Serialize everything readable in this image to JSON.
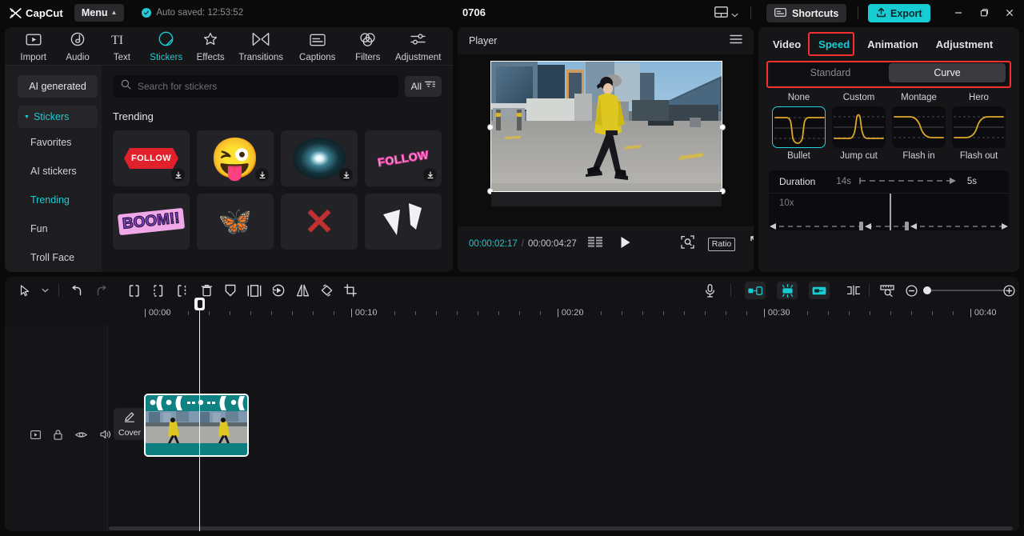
{
  "titlebar": {
    "brand": "CapCut",
    "menu_label": "Menu",
    "autosave": "Auto saved: 12:53:52",
    "project_title": "0706",
    "shortcuts_label": "Shortcuts",
    "export_label": "Export",
    "layout_icon": "layout-icon",
    "minimize_icon": "minimize-icon",
    "maximize_icon": "maximize-icon",
    "close_icon": "close-icon"
  },
  "left_panel": {
    "tabs": [
      {
        "label": "Import",
        "icon": "import-icon",
        "active": false
      },
      {
        "label": "Audio",
        "icon": "audio-icon",
        "active": false
      },
      {
        "label": "Text",
        "icon": "text-icon",
        "active": false
      },
      {
        "label": "Stickers",
        "icon": "stickers-icon",
        "active": true
      },
      {
        "label": "Effects",
        "icon": "effects-icon",
        "active": false
      },
      {
        "label": "Transitions",
        "icon": "transitions-icon",
        "active": false
      },
      {
        "label": "Captions",
        "icon": "captions-icon",
        "active": false
      },
      {
        "label": "Filters",
        "icon": "filters-icon",
        "active": false
      },
      {
        "label": "Adjustment",
        "icon": "adjustment-icon",
        "active": false
      }
    ],
    "sidebar": {
      "ai_generated": "AI generated",
      "group_label": "Stickers",
      "items": [
        {
          "label": "Favorites",
          "selected": false
        },
        {
          "label": "AI stickers",
          "selected": false
        },
        {
          "label": "Trending",
          "selected": true
        },
        {
          "label": "Fun",
          "selected": false
        },
        {
          "label": "Troll Face",
          "selected": false
        }
      ]
    },
    "search": {
      "placeholder": "Search for stickers",
      "value": "",
      "icon": "search-icon"
    },
    "filter_button": {
      "label": "All",
      "icon": "filter-icon"
    },
    "section_title": "Trending",
    "stickers": [
      {
        "name": "follow-red-banner-sticker",
        "art": "follow-red",
        "text": "FOLLOW"
      },
      {
        "name": "winking-tongue-emoji-sticker",
        "art": "emoji",
        "text": "😜"
      },
      {
        "name": "sparkle-burst-sticker",
        "art": "spark",
        "text": ""
      },
      {
        "name": "follow-pink-outline-sticker",
        "art": "follow-pink",
        "text": "FOLLOW"
      },
      {
        "name": "boom-comic-sticker",
        "art": "boom",
        "text": "BOOM!!"
      },
      {
        "name": "butterfly-sticker",
        "art": "butterfly",
        "text": "🦋"
      },
      {
        "name": "red-x-mark-sticker",
        "art": "x",
        "text": "✕"
      },
      {
        "name": "white-arrow-shards-sticker",
        "art": "shards",
        "text": ""
      }
    ]
  },
  "player": {
    "title": "Player",
    "menu_icon": "hamburger-icon",
    "current_time": "00:00:02:17",
    "time_separator": "/",
    "total_time": "00:00:04:27",
    "frames_icon": "frames-icon",
    "play_icon": "play-icon",
    "zoom_fit_icon": "zoom-fit-icon",
    "ratio_label": "Ratio",
    "fullscreen_icon": "fullscreen-icon"
  },
  "right_panel": {
    "tabs": [
      {
        "label": "Video",
        "active": false,
        "highlighted": false
      },
      {
        "label": "Speed",
        "active": true,
        "highlighted": true
      },
      {
        "label": "Animation",
        "active": false,
        "highlighted": false
      },
      {
        "label": "Adjustment",
        "active": false,
        "highlighted": false
      }
    ],
    "mode_toggle": {
      "highlighted": true,
      "options": [
        {
          "label": "Standard",
          "selected": false
        },
        {
          "label": "Curve",
          "selected": true
        }
      ]
    },
    "preset_row_top_labels": [
      "None",
      "Custom",
      "Montage",
      "Hero"
    ],
    "presets": [
      {
        "label": "Bullet",
        "curve": "bullet",
        "selected": true
      },
      {
        "label": "Jump cut",
        "curve": "jumpcut",
        "selected": false
      },
      {
        "label": "Flash in",
        "curve": "flashin",
        "selected": false
      },
      {
        "label": "Flash out",
        "curve": "flashout",
        "selected": false
      }
    ],
    "duration": {
      "label": "Duration",
      "from": "14s",
      "to": "5s",
      "max_speed": "10x"
    },
    "accent_color": "#17cdd4",
    "highlight_color": "#f3302f",
    "curve_color": "#e0a82a"
  },
  "timeline": {
    "tools_left": [
      {
        "name": "select-tool-icon"
      },
      {
        "name": "chevron-down-icon"
      },
      {
        "name": "undo-icon"
      },
      {
        "name": "redo-icon"
      },
      {
        "name": "split-left-icon"
      },
      {
        "name": "split-right-icon"
      },
      {
        "name": "split-icon"
      },
      {
        "name": "delete-icon"
      },
      {
        "name": "freeze-icon"
      },
      {
        "name": "crop-frame-icon"
      },
      {
        "name": "reverse-icon"
      },
      {
        "name": "mirror-icon"
      },
      {
        "name": "rotate-icon"
      },
      {
        "name": "crop-icon"
      }
    ],
    "tools_right": [
      {
        "name": "microphone-icon"
      },
      {
        "name": "auto-fit-left-icon"
      },
      {
        "name": "auto-fit-center-icon"
      },
      {
        "name": "auto-fit-right-icon"
      },
      {
        "name": "split-marker-icon"
      },
      {
        "name": "ruler-zoom-icon"
      },
      {
        "name": "zoom-out-icon"
      },
      {
        "name": "zoom-in-icon"
      }
    ],
    "ruler_labels": [
      "| 00:00",
      "| 00:10",
      "| 00:20",
      "| 00:30",
      "| 00:40"
    ],
    "track_icons": [
      {
        "name": "track-type-icon"
      },
      {
        "name": "lock-icon"
      },
      {
        "name": "eye-icon"
      },
      {
        "name": "volume-icon"
      },
      {
        "name": "more-options-icon"
      }
    ],
    "cover_button": {
      "label": "Cover",
      "icon": "pencil-icon"
    },
    "clip": {
      "name": "video-clip",
      "speed_curve_visible": true
    }
  }
}
